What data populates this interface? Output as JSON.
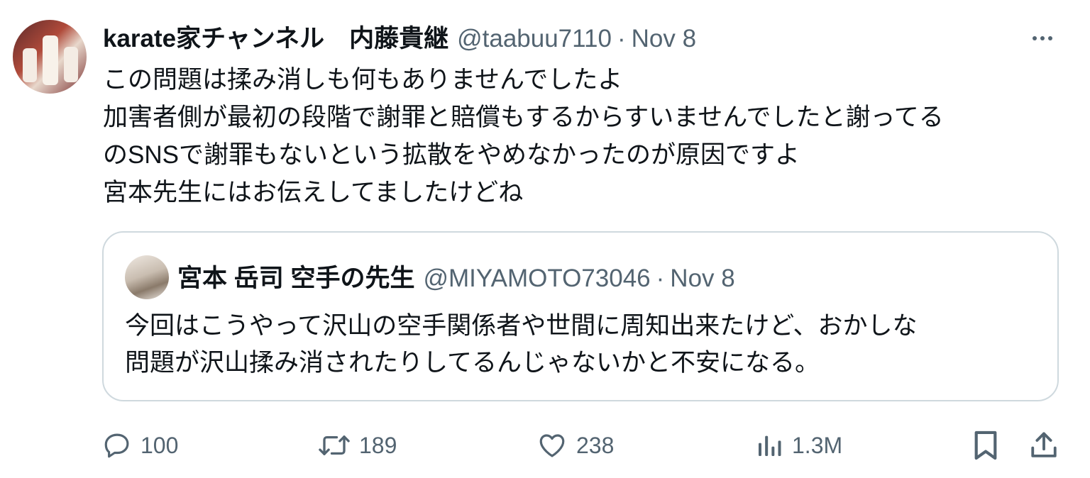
{
  "tweet": {
    "display_name": "karate家チャンネル　内藤貴継",
    "handle": "@taabuu7110",
    "separator": "·",
    "date": "Nov 8",
    "avatar_icon": "profile-photo",
    "more_icon": "more-horizontal-icon",
    "text_lines": [
      "この問題は揉み消しも何もありませんでしたよ",
      "加害者側が最初の段階で謝罪と賠償もするからすいませんでしたと謝ってる",
      "のSNSで謝罪もないという拡散をやめなかったのが原因ですよ",
      "宮本先生にはお伝えしてましたけどね"
    ]
  },
  "quoted_tweet": {
    "display_name": "宮本 岳司 空手の先生",
    "handle": "@MIYAMOTO73046",
    "separator": "·",
    "date": "Nov 8",
    "text_lines": [
      "今回はこうやって沢山の空手関係者や世間に周知出来たけど、おかしな",
      "問題が沢山揉み消されたりしてるんじゃないかと不安になる。"
    ]
  },
  "actions": {
    "reply": {
      "icon": "reply-icon",
      "count": "100"
    },
    "repost": {
      "icon": "repost-icon",
      "count": "189"
    },
    "like": {
      "icon": "heart-icon",
      "count": "238"
    },
    "views": {
      "icon": "views-chart-icon",
      "count": "1.3M"
    },
    "bookmark": {
      "icon": "bookmark-icon"
    },
    "share": {
      "icon": "share-icon"
    }
  },
  "colors": {
    "text_primary": "#0f1419",
    "text_secondary": "#536471",
    "border": "#cfd9de",
    "background": "#ffffff"
  }
}
